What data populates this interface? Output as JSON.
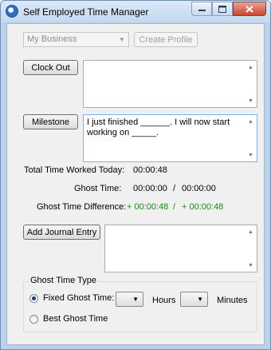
{
  "window": {
    "title": "Self Employed Time Manager",
    "icons": {
      "app": "clock-app-icon",
      "minimize": "minimize-icon",
      "maximize": "maximize-icon",
      "close": "close-icon"
    }
  },
  "profile": {
    "selected": "My Business",
    "create_label": "Create Profile"
  },
  "clock": {
    "button_label": "Clock Out",
    "text": ""
  },
  "milestone": {
    "button_label": "Milestone",
    "text": "I just finished ______. I will now start working on _____."
  },
  "stats": {
    "total_label": "Total Time Worked Today:",
    "total_value": "00:00:48",
    "ghost_label": "Ghost Time:",
    "ghost_value_a": "00:00:00",
    "ghost_sep": "/",
    "ghost_value_b": "00:00:00",
    "diff_label": "Ghost Time Difference:",
    "diff_value_a": "+ 00:00:48",
    "diff_sep": "/",
    "diff_value_b": "+ 00:00:48"
  },
  "journal": {
    "button_label": "Add Journal Entry",
    "text": ""
  },
  "ghost_type": {
    "group_title": "Ghost Time Type",
    "fixed_label": "Fixed Ghost Time:",
    "fixed_selected": true,
    "hours_label": "Hours",
    "minutes_label": "Minutes",
    "best_label": "Best Ghost Time",
    "best_selected": false
  },
  "colors": {
    "positive": "#1b8a1b",
    "title_bar": "#c4d8ee"
  }
}
